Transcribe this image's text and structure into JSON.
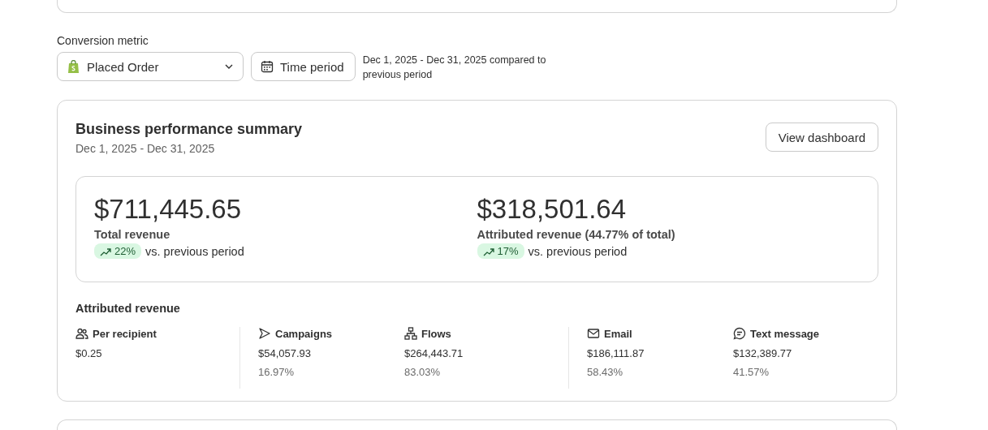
{
  "conversion_metric": {
    "label": "Conversion metric",
    "value": "Placed Order",
    "time_button": "Time period",
    "range_note": "Dec 1, 2025 - Dec 31, 2025 compared to previous period"
  },
  "summary": {
    "title": "Business performance summary",
    "subtitle": "Dec 1, 2025 - Dec 31, 2025",
    "button": "View dashboard",
    "totals": [
      {
        "amount": "$711,445.65",
        "label": "Total revenue",
        "change": "22%",
        "kind": "up",
        "note": "vs. previous period"
      },
      {
        "amount": "$318,501.64",
        "label": "Attributed revenue (44.77% of total)",
        "change": "17%",
        "kind": "up",
        "note": "vs. previous period"
      }
    ],
    "attributed": {
      "title": "Attributed revenue",
      "groups": [
        [
          {
            "kind": "people",
            "label": "Per recipient",
            "value": "$0.25"
          }
        ],
        [
          {
            "kind": "send",
            "label": "Campaigns",
            "value": "$54,057.93",
            "share": "16.97%"
          },
          {
            "kind": "flow",
            "label": "Flows",
            "value": "$264,443.71",
            "share": "83.03%"
          }
        ],
        [
          {
            "kind": "email",
            "label": "Email",
            "value": "$186,111.87",
            "share": "58.43%"
          },
          {
            "kind": "sms",
            "label": "Text message",
            "value": "$132,389.77",
            "share": "41.57%"
          }
        ]
      ]
    }
  }
}
